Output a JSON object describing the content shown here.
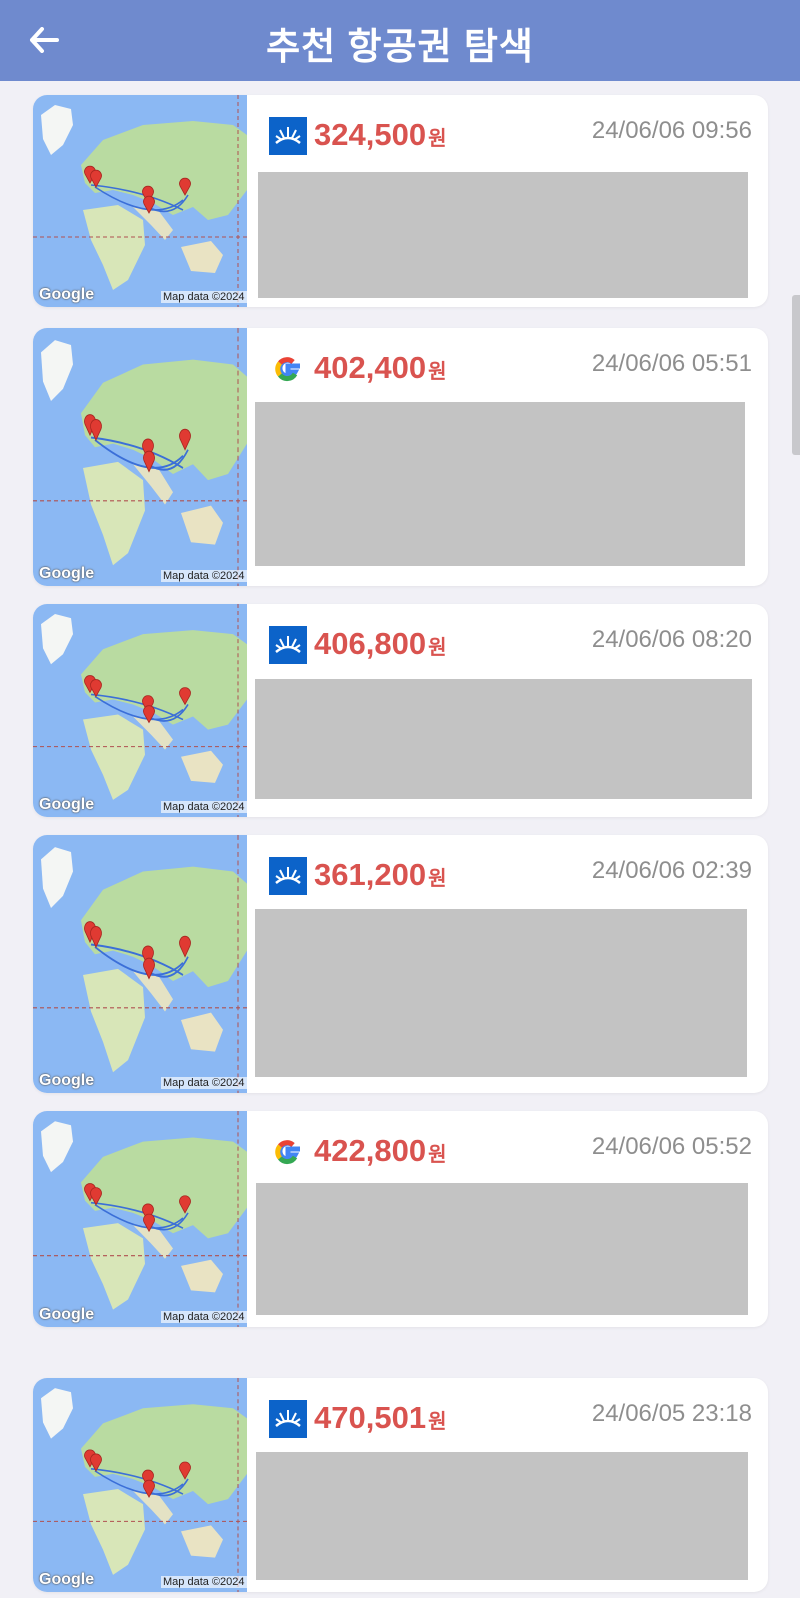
{
  "header": {
    "title": "추천 항공권 탐색",
    "back_icon": "arrow-left-icon"
  },
  "colors": {
    "header_bg": "#6f8ace",
    "price": "#d9534f",
    "time": "#8e8e8e",
    "placeholder": "#c3c3c3"
  },
  "map_labels": {
    "google": "Google",
    "map_data": "Map data ©2024"
  },
  "results": [
    {
      "airline_icon": "sunrise-airline-logo-icon",
      "price": "324,500",
      "currency": "원",
      "datetime": "24/06/06 09:56"
    },
    {
      "airline_icon": "google-logo-icon",
      "price": "402,400",
      "currency": "원",
      "datetime": "24/06/06 05:51"
    },
    {
      "airline_icon": "sunrise-airline-logo-icon",
      "price": "406,800",
      "currency": "원",
      "datetime": "24/06/06 08:20"
    },
    {
      "airline_icon": "sunrise-airline-logo-icon",
      "price": "361,200",
      "currency": "원",
      "datetime": "24/06/06 02:39"
    },
    {
      "airline_icon": "google-logo-icon",
      "price": "422,800",
      "currency": "원",
      "datetime": "24/06/06 05:52"
    },
    {
      "airline_icon": "sunrise-airline-logo-icon",
      "price": "470,501",
      "currency": "원",
      "datetime": "24/06/05 23:18"
    }
  ]
}
